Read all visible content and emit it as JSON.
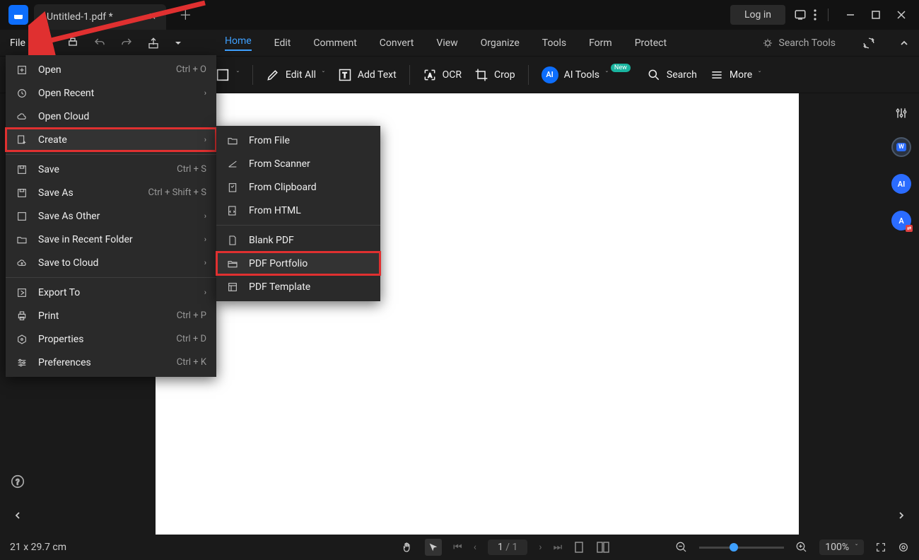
{
  "titlebar": {
    "tab_title": "Untitled-1.pdf *",
    "login": "Log in"
  },
  "menubar": {
    "file": "File",
    "ribbon_tabs": [
      "Home",
      "Edit",
      "Comment",
      "Convert",
      "View",
      "Organize",
      "Tools",
      "Form",
      "Protect"
    ],
    "search_tools": "Search Tools"
  },
  "ribbon": {
    "edit_all": "Edit All",
    "add_text": "Add Text",
    "ocr": "OCR",
    "crop": "Crop",
    "ai_tools": "AI Tools",
    "ai_new": "New",
    "search": "Search",
    "more": "More"
  },
  "file_menu": {
    "open": {
      "label": "Open",
      "shortcut": "Ctrl + O"
    },
    "open_recent": {
      "label": "Open Recent"
    },
    "open_cloud": {
      "label": "Open Cloud"
    },
    "create": {
      "label": "Create"
    },
    "save": {
      "label": "Save",
      "shortcut": "Ctrl + S"
    },
    "save_as": {
      "label": "Save As",
      "shortcut": "Ctrl + Shift + S"
    },
    "save_as_other": {
      "label": "Save As Other"
    },
    "save_recent_folder": {
      "label": "Save in Recent Folder"
    },
    "save_cloud": {
      "label": "Save to Cloud"
    },
    "export_to": {
      "label": "Export To"
    },
    "print": {
      "label": "Print",
      "shortcut": "Ctrl + P"
    },
    "properties": {
      "label": "Properties",
      "shortcut": "Ctrl + D"
    },
    "preferences": {
      "label": "Preferences",
      "shortcut": "Ctrl + K"
    }
  },
  "create_submenu": {
    "from_file": "From File",
    "from_scanner": "From Scanner",
    "from_clipboard": "From Clipboard",
    "from_html": "From HTML",
    "blank_pdf": "Blank PDF",
    "pdf_portfolio": "PDF Portfolio",
    "pdf_template": "PDF Template"
  },
  "status": {
    "dims": "21 x 29.7 cm",
    "page_current": "1",
    "page_total": "/ 1",
    "zoom": "100%"
  },
  "right_rail": {
    "w_badge": "W",
    "ai_badge": "AI",
    "at_badge": "A"
  }
}
